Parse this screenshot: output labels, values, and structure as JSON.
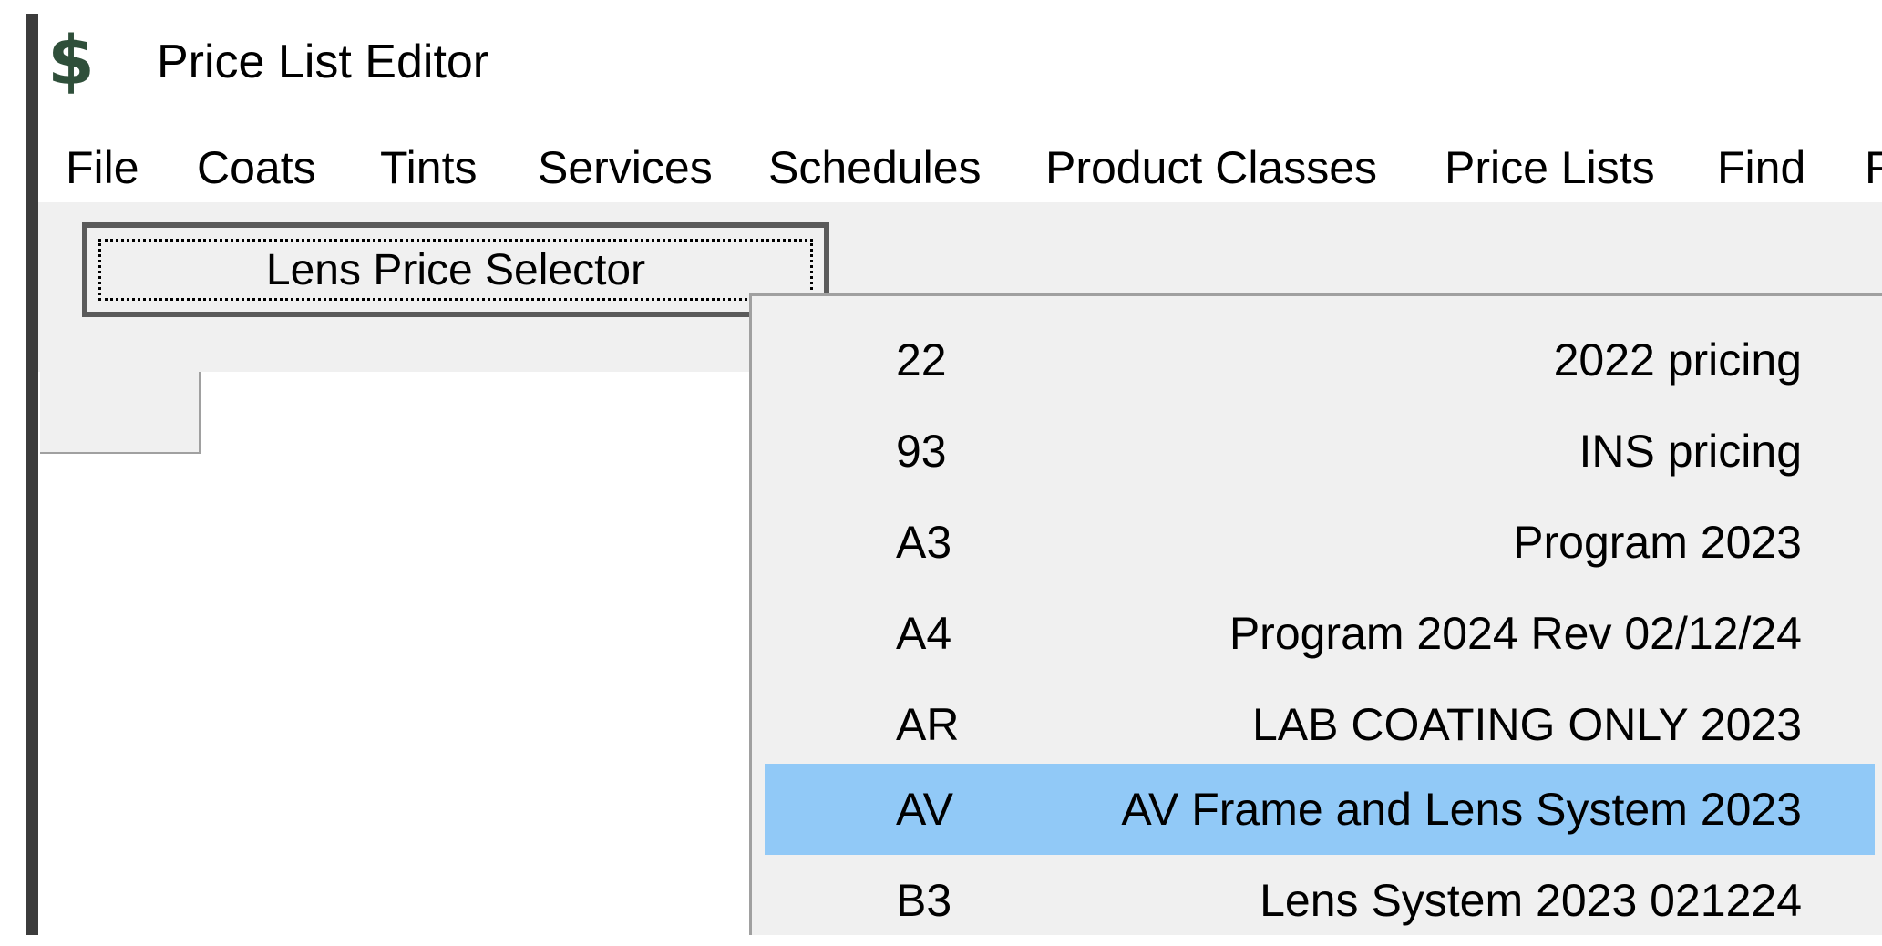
{
  "window": {
    "title": "Price List Editor",
    "app_icon_glyph": "$",
    "app_icon": "dollar-icon"
  },
  "menu": {
    "items": [
      {
        "label": "File"
      },
      {
        "label": "Coats"
      },
      {
        "label": "Tints"
      },
      {
        "label": "Services"
      },
      {
        "label": "Schedules"
      },
      {
        "label": "Product Classes"
      },
      {
        "label": "Price Lists"
      },
      {
        "label": "Find"
      },
      {
        "label": "F"
      }
    ]
  },
  "toolbar": {
    "lens_price_selector_label": "Lens Price Selector"
  },
  "dropdown": {
    "items": [
      {
        "code": "22",
        "description": "2022 pricing",
        "selected": false
      },
      {
        "code": "93",
        "description": "INS pricing",
        "selected": false
      },
      {
        "code": "A3",
        "description": "Program 2023",
        "selected": false
      },
      {
        "code": "A4",
        "description": "Program 2024 Rev 02/12/24",
        "selected": false
      },
      {
        "code": "AR",
        "description": "LAB COATING ONLY 2023",
        "selected": false
      },
      {
        "code": "AV",
        "description": "AV Frame and Lens System 2023",
        "selected": true
      },
      {
        "code": "B3",
        "description": "Lens System 2023 021224",
        "selected": false
      }
    ]
  },
  "colors": {
    "highlight": "#91c9f7",
    "menu_background": "#f0f0f0",
    "icon_green": "#2f4f3a"
  }
}
